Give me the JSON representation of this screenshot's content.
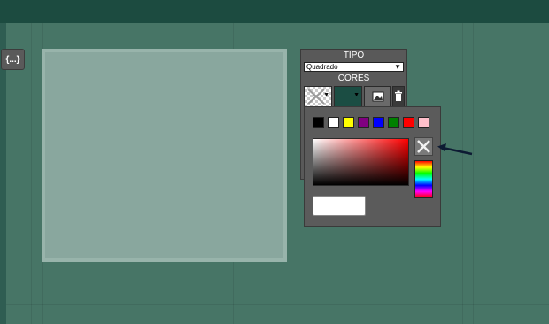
{
  "sidebar": {
    "collapse_label": "{...}"
  },
  "panel": {
    "type_label": "TIPO",
    "type_value": "Quadrado",
    "colors_label": "CORES",
    "color_selected": "#1b4d43"
  },
  "picker": {
    "presets": [
      "#000000",
      "#ffffff",
      "#ffff00",
      "#800080",
      "#0000ff",
      "#008000",
      "#ff0000",
      "#ffc0cb"
    ],
    "hex_value": "",
    "hue_base": "#ff0000"
  },
  "icons": {
    "dropdown": "chevron-down-icon",
    "image": "image-icon",
    "trash": "trash-icon",
    "clear": "close-icon",
    "arrow": "arrow-left-icon"
  }
}
